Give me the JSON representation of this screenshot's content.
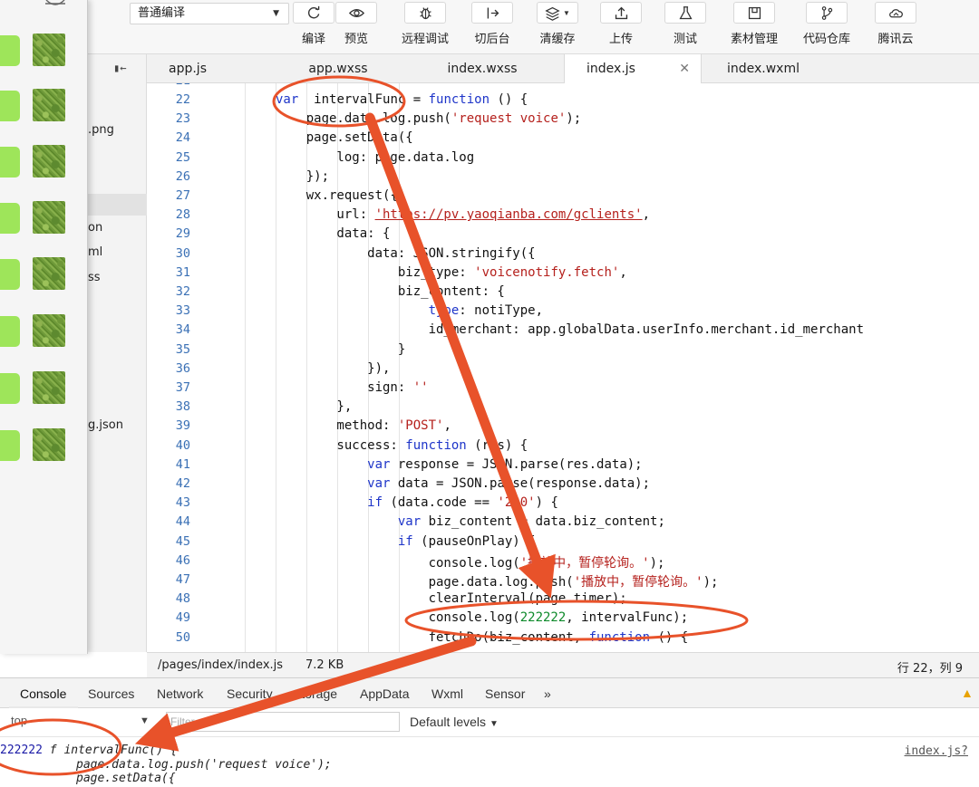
{
  "toolbar": {
    "compile_mode": "普通编译",
    "buttons": [
      {
        "label": "编译",
        "icon": "refresh-icon"
      },
      {
        "label": "预览",
        "icon": "eye-icon"
      },
      {
        "label": "远程调试",
        "icon": "bug-icon"
      },
      {
        "label": "切后台",
        "icon": "switch-background-icon"
      },
      {
        "label": "清缓存",
        "icon": "layers-icon"
      },
      {
        "label": "上传",
        "icon": "upload-icon"
      },
      {
        "label": "测试",
        "icon": "flask-icon"
      },
      {
        "label": "素材管理",
        "icon": "material-icon"
      },
      {
        "label": "代码仓库",
        "icon": "branch-icon"
      },
      {
        "label": "腾讯云",
        "icon": "cloud-icon"
      }
    ]
  },
  "file_tree": {
    "items": [
      ".png",
      "on",
      "ml",
      "ss",
      "g.json"
    ]
  },
  "tabs": [
    {
      "label": "app.js",
      "active": false
    },
    {
      "label": "app.wxss",
      "active": false
    },
    {
      "label": "index.wxss",
      "active": false
    },
    {
      "label": "index.js",
      "active": true
    },
    {
      "label": "index.wxml",
      "active": false
    }
  ],
  "code": {
    "partial_line_number": "21",
    "line_numbers": [
      "22",
      "23",
      "24",
      "25",
      "26",
      "27",
      "28",
      "29",
      "30",
      "31",
      "32",
      "33",
      "34",
      "35",
      "36",
      "37",
      "38",
      "39",
      "40",
      "41",
      "42",
      "43",
      "44",
      "45",
      "46",
      "47",
      "48",
      "49",
      "50"
    ],
    "lines": [
      [
        [
          "kw",
          "var"
        ],
        [
          "",
          "  intervalFunc = "
        ],
        [
          "kw",
          "function"
        ],
        [
          "",
          " () {"
        ]
      ],
      [
        [
          "",
          "    page.data.log.push("
        ],
        [
          "str",
          "'request voice'"
        ],
        [
          "",
          ");"
        ]
      ],
      [
        [
          "",
          "    page.setData({"
        ]
      ],
      [
        [
          "",
          "        log: page.data.log"
        ]
      ],
      [
        [
          "",
          "    });"
        ]
      ],
      [
        [
          "",
          "    wx.request({"
        ]
      ],
      [
        [
          "",
          "        url: "
        ],
        [
          "url",
          "'https://pv.yaoqianba.com/gclients'"
        ],
        [
          "",
          ","
        ]
      ],
      [
        [
          "",
          "        data: {"
        ]
      ],
      [
        [
          "",
          "            data: JSON.stringify({"
        ]
      ],
      [
        [
          "",
          "                biz_type: "
        ],
        [
          "str",
          "'voicenotify.fetch'"
        ],
        [
          "",
          ","
        ]
      ],
      [
        [
          "",
          "                biz_content: {"
        ]
      ],
      [
        [
          "",
          "                    "
        ],
        [
          "kw",
          "type"
        ],
        [
          "",
          ": notiType,"
        ]
      ],
      [
        [
          "",
          "                    id_merchant: app.globalData.userInfo.merchant.id_merchant"
        ]
      ],
      [
        [
          "",
          "                }"
        ]
      ],
      [
        [
          "",
          "            }),"
        ]
      ],
      [
        [
          "",
          "            sign: "
        ],
        [
          "str",
          "''"
        ]
      ],
      [
        [
          "",
          "        },"
        ]
      ],
      [
        [
          "",
          "        method: "
        ],
        [
          "str",
          "'POST'"
        ],
        [
          "",
          ","
        ]
      ],
      [
        [
          "",
          "        success: "
        ],
        [
          "kw",
          "function"
        ],
        [
          "",
          " (res) {"
        ]
      ],
      [
        [
          "",
          "            "
        ],
        [
          "kw",
          "var"
        ],
        [
          "",
          " response = JSON.parse(res.data);"
        ]
      ],
      [
        [
          "",
          "            "
        ],
        [
          "kw",
          "var"
        ],
        [
          "",
          " data = JSON.parse(response.data);"
        ]
      ],
      [
        [
          "",
          "            "
        ],
        [
          "kw",
          "if"
        ],
        [
          "",
          " (data.code == "
        ],
        [
          "str",
          "'200'"
        ],
        [
          "",
          ") {"
        ]
      ],
      [
        [
          "",
          "                "
        ],
        [
          "kw",
          "var"
        ],
        [
          "",
          " biz_content = data.biz_content;"
        ]
      ],
      [
        [
          "",
          "                "
        ],
        [
          "kw",
          "if"
        ],
        [
          "",
          " (pauseOnPlay) {"
        ]
      ],
      [
        [
          "",
          "                    console.log("
        ],
        [
          "str",
          "'播放中，暂停轮询。'"
        ],
        [
          "",
          ");"
        ]
      ],
      [
        [
          "",
          "                    page.data.log.push("
        ],
        [
          "str",
          "'播放中，暂停轮询。'"
        ],
        [
          "",
          ");"
        ]
      ],
      [
        [
          "",
          "                    clearInterval(page.timer);"
        ]
      ],
      [
        [
          "",
          "                    console.log("
        ],
        [
          "num",
          "222222"
        ],
        [
          "",
          ", intervalFunc);"
        ]
      ],
      [
        [
          "",
          "                    fetchDo(biz_content, "
        ],
        [
          "kw",
          "function"
        ],
        [
          "",
          " () {"
        ]
      ]
    ]
  },
  "status": {
    "path": "/pages/index/index.js",
    "size": "7.2 KB",
    "position": "行 22，列 9"
  },
  "devtools": {
    "tabs": [
      "Console",
      "Sources",
      "Network",
      "Security",
      "Storage",
      "AppData",
      "Wxml",
      "Sensor"
    ],
    "more": "»",
    "context": "top",
    "filter_placeholder": "Filter",
    "levels": "Default levels"
  },
  "console_output": {
    "number": "222222",
    "fn_header": " f intervalFunc() {",
    "line2": "page.data.log.push('request voice');",
    "line3": "page.setData({",
    "source": "index.js?"
  },
  "colors": {
    "annotation": "#e8522a",
    "keyword": "#1e35c9",
    "string": "#b5211d",
    "line_number": "#3a70b5",
    "bubble": "#9ee55a"
  }
}
